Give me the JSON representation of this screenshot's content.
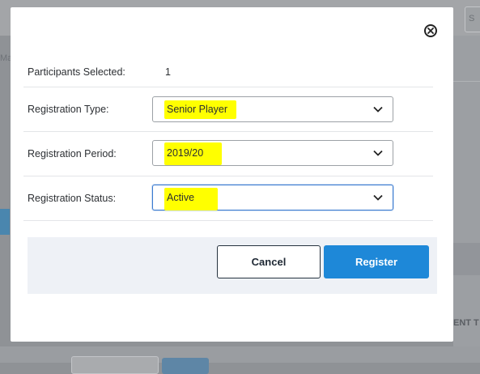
{
  "background": {
    "top_button_label": "S",
    "left_fragment": "Ma",
    "right_fragment": "ENT T"
  },
  "dialog": {
    "close_icon": "close-circle-icon",
    "participants": {
      "label": "Participants Selected:",
      "value": "1"
    },
    "fields": [
      {
        "label": "Registration Type:",
        "value": "Senior Player"
      },
      {
        "label": "Registration Period:",
        "value": "2019/20"
      },
      {
        "label": "Registration Status:",
        "value": "Active"
      }
    ],
    "highlight_color": "#ffff00",
    "buttons": {
      "cancel_label": "Cancel",
      "register_label": "Register"
    },
    "accent_color": "#1e88d8"
  }
}
